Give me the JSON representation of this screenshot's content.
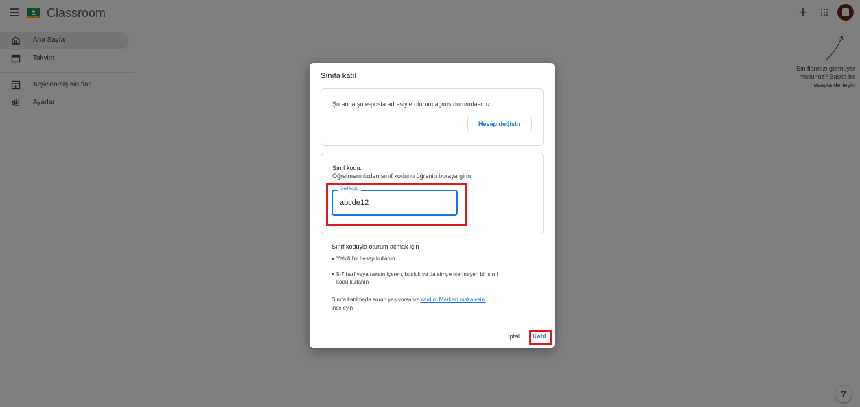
{
  "app": {
    "title": "Classroom"
  },
  "sidebar": {
    "items": [
      {
        "label": "Ana Sayfa",
        "icon": "home-icon"
      },
      {
        "label": "Takvim",
        "icon": "calendar-icon"
      },
      {
        "label": "Arşivlenmiş sınıflar",
        "icon": "archive-icon"
      },
      {
        "label": "Ayarlar",
        "icon": "gear-icon"
      }
    ]
  },
  "hint": {
    "line1": "Sınıflarınızı görmüyor",
    "line2": "musunuz? Başka bir",
    "line3": "hesapla deneyin"
  },
  "dialog": {
    "title": "Sınıfa katıl",
    "signed_in_text": "Şu anda şu e-posta adresiyle oturum açmış durumdasınız:",
    "switch_account": "Hesap değiştir",
    "code_title": "Sınıf kodu:",
    "code_subtitle": "Öğretmeninizden sınıf kodunu öğrenip buraya girin.",
    "code_field_label": "Sınıf kodu:",
    "code_value": "abcde12",
    "info_title": "Sınıf koduyla oturum açmak için",
    "bullet1": "Yetkili bir hesap kullanın",
    "bullet2_line1": "5-7 harf veya rakam içeren, boşluk ya da simge içermeyen bir sınıf",
    "bullet2_line2": "kodu kullanın",
    "trouble_prefix": "Sınıfa katılmada sorun yaşıyorsanız",
    "trouble_link": "Yardım Merkezi makalesini",
    "trouble_suffix": "inceleyin",
    "cancel": "İptal",
    "join": "Katıl"
  },
  "colors": {
    "accent": "#1a73e8",
    "highlight": "#e0191f",
    "scrim": "rgba(0,0,0,0.5)"
  }
}
